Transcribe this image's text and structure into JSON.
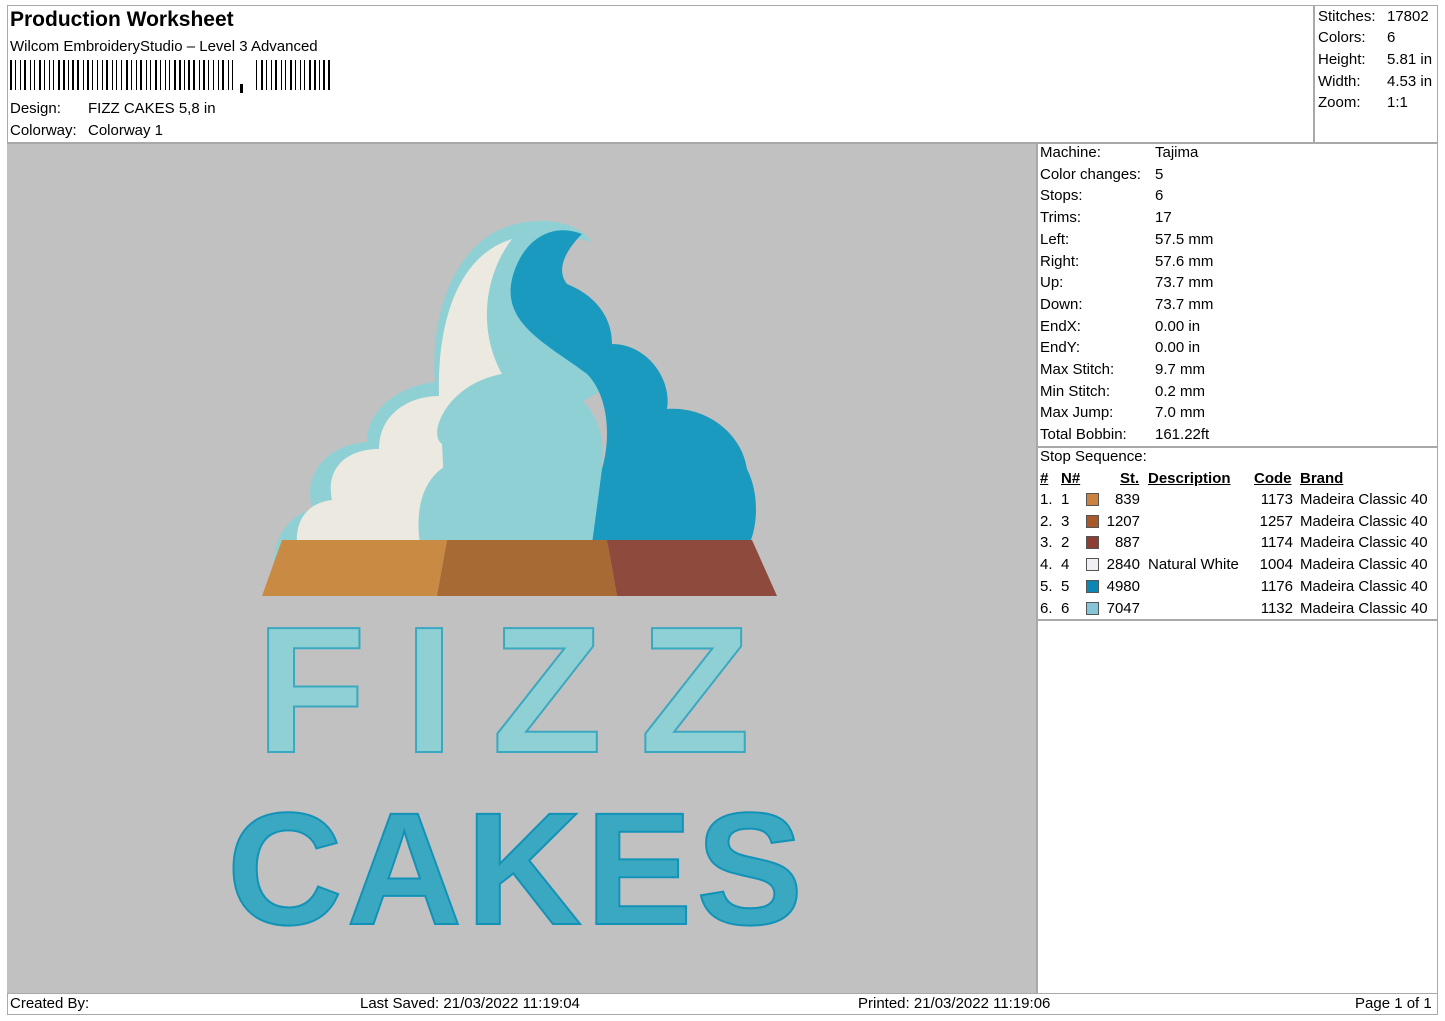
{
  "header": {
    "title": "Production Worksheet",
    "software": "Wilcom EmbroideryStudio – Level 3 Advanced",
    "design_label": "Design:",
    "design_value": "FIZZ CAKES 5,8 in",
    "colorway_label": "Colorway:",
    "colorway_value": "Colorway 1"
  },
  "summary": {
    "stitches_label": "Stitches:",
    "stitches": "17802",
    "colors_label": "Colors:",
    "colors": "6",
    "height_label": "Height:",
    "height": "5.81 in",
    "width_label": "Width:",
    "width": "4.53 in",
    "zoom_label": "Zoom:",
    "zoom": "1:1"
  },
  "machine_info": [
    {
      "label": "Machine:",
      "value": "Tajima"
    },
    {
      "label": "Color changes:",
      "value": "5"
    },
    {
      "label": "Stops:",
      "value": "6"
    },
    {
      "label": "Trims:",
      "value": "17"
    },
    {
      "label": "Left:",
      "value": "57.5 mm"
    },
    {
      "label": "Right:",
      "value": "57.6 mm"
    },
    {
      "label": "Up:",
      "value": "73.7 mm"
    },
    {
      "label": "Down:",
      "value": "73.7 mm"
    },
    {
      "label": "EndX:",
      "value": "0.00 in"
    },
    {
      "label": "EndY:",
      "value": "0.00 in"
    },
    {
      "label": "Max Stitch:",
      "value": "9.7 mm"
    },
    {
      "label": "Min Stitch:",
      "value": "0.2 mm"
    },
    {
      "label": "Max Jump:",
      "value": "7.0 mm"
    },
    {
      "label": "Total Bobbin:",
      "value": "161.22ft"
    }
  ],
  "stop_sequence": {
    "title": "Stop Sequence:",
    "headers": {
      "num": "#",
      "n": "N#",
      "st": "St.",
      "description": "Description",
      "code": "Code",
      "brand": "Brand"
    },
    "rows": [
      {
        "num": "1.",
        "n": "1",
        "color": "#c9823f",
        "st": "839",
        "description": "",
        "code": "1173",
        "brand": "Madeira Classic 40"
      },
      {
        "num": "2.",
        "n": "3",
        "color": "#a65a2a",
        "st": "1207",
        "description": "",
        "code": "1257",
        "brand": "Madeira Classic 40"
      },
      {
        "num": "3.",
        "n": "2",
        "color": "#8e3d33",
        "st": "887",
        "description": "",
        "code": "1174",
        "brand": "Madeira Classic 40"
      },
      {
        "num": "4.",
        "n": "4",
        "color": "#f0f0f4",
        "st": "2840",
        "description": "Natural White",
        "code": "1004",
        "brand": "Madeira Classic 40"
      },
      {
        "num": "5.",
        "n": "5",
        "color": "#0c86b4",
        "st": "4980",
        "description": "",
        "code": "1176",
        "brand": "Madeira Classic 40"
      },
      {
        "num": "6.",
        "n": "6",
        "color": "#86c4d8",
        "st": "7047",
        "description": "",
        "code": "1132",
        "brand": "Madeira Classic 40"
      }
    ]
  },
  "design_preview": {
    "line1": "FIZZ",
    "line2": "CAKES",
    "colors": {
      "canvas": "#c1c1c1",
      "cream_white": "#ece9e0",
      "light_teal": "#8fd0d4",
      "mid_teal": "#3aa8c0",
      "dark_teal": "#1292b8",
      "tan": "#c98a44",
      "brown": "#a86a34",
      "red_brown": "#8e4a3c"
    }
  },
  "footer": {
    "created_by": "Created By:",
    "last_saved": "Last Saved: 21/03/2022 11:19:04",
    "printed": "Printed: 21/03/2022 11:19:06",
    "page": "Page 1 of 1"
  }
}
